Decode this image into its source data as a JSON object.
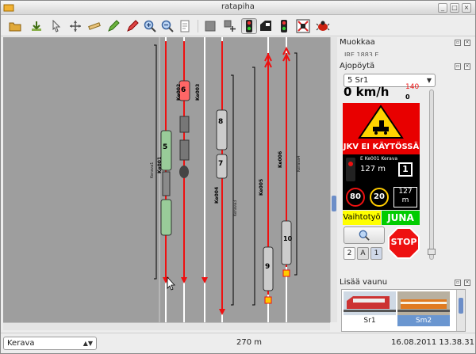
{
  "window": {
    "title": "ratapiha",
    "controls": [
      "minimize-icon",
      "maximize-icon",
      "close-icon"
    ]
  },
  "toolbar": {
    "icons": [
      "open-folder-icon",
      "download-icon",
      "pointer-icon",
      "move-icon",
      "ruler-icon",
      "pencil-icon",
      "eraser-icon",
      "zoom-in-icon",
      "zoom-out-icon",
      "page-icon",
      "stop-square-icon",
      "add-block-icon",
      "signal-icon",
      "train-icon",
      "green-signal-icon",
      "switch-icon",
      "bug-icon"
    ]
  },
  "tracks": {
    "labels": [
      "Ke001",
      "Ke002",
      "Ke003",
      "Ke004",
      "Ke005",
      "Ke006"
    ],
    "small_labels": [
      "Kerava1",
      "Kerava3",
      "Kerava4"
    ],
    "trains": [
      "5",
      "6",
      "7",
      "8",
      "9",
      "10"
    ]
  },
  "muokkaa": {
    "title": "Muokkaa",
    "partial_text": "IRE 1883.E"
  },
  "ajopoyta": {
    "title": "Ajopöytä",
    "train_select": "5 Sr1",
    "speed": "0 km/h",
    "speed_limit": "140",
    "speed_target": "0",
    "jkv_text": "JKV EI KÄYTÖSSÄ",
    "next_signal": "E Ke001 Kerava",
    "signal_distance": "127 m",
    "signal_number": "1",
    "limit_1": "80",
    "limit_2": "20",
    "limit_distance": "127",
    "limit_unit": "m",
    "mode_1": "Vaihtotyö",
    "mode_2": "JUNA",
    "stop_label": "STOP",
    "gear_buttons": [
      "2",
      "A",
      "1"
    ]
  },
  "lisaa_vaunu": {
    "title": "Lisää vaunu",
    "cars": [
      {
        "label": "Sr1"
      },
      {
        "label": "Sm2"
      }
    ]
  },
  "status": {
    "station": "Kerava",
    "distance": "270 m",
    "datetime": "16.08.2011 13.38.31"
  }
}
